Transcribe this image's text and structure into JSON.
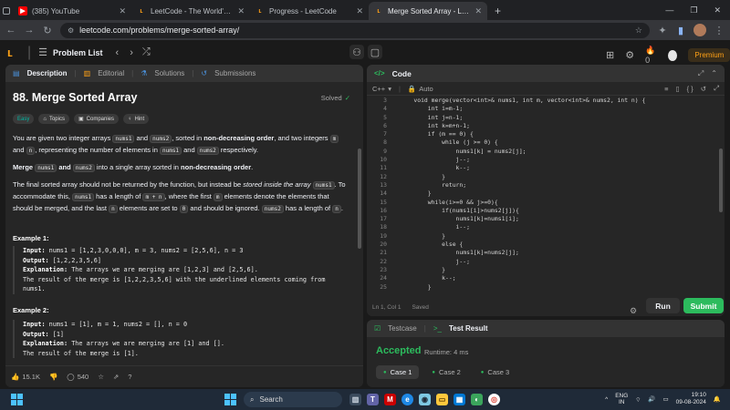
{
  "browser": {
    "tabs": [
      {
        "title": "(385) YouTube",
        "icon": "youtube-icon"
      },
      {
        "title": "LeetCode - The World's Leading",
        "icon": "leetcode-icon"
      },
      {
        "title": "Progress - LeetCode",
        "icon": "leetcode-icon"
      },
      {
        "title": "Merge Sorted Array - LeetCode",
        "icon": "leetcode-icon"
      }
    ],
    "url": "leetcode.com/problems/merge-sorted-array/"
  },
  "lcnav": {
    "problem_list": "Problem List",
    "streak": "0",
    "premium": "Premium"
  },
  "left": {
    "tabs": [
      "Description",
      "Editorial",
      "Solutions",
      "Submissions"
    ],
    "title": "88. Merge Sorted Array",
    "status": "Solved",
    "chips": [
      "Easy",
      "Topics",
      "Companies",
      "Hint"
    ],
    "p1": {
      "a": "You are given two integer arrays ",
      "c1": "nums1",
      "b": " and ",
      "c2": "nums2",
      "c": ", sorted in ",
      "bold": "non-decreasing order",
      "d": ", and two integers ",
      "c3": "m",
      "e": " and ",
      "c4": "n",
      "f": ", representing the number of elements in ",
      "c5": "nums1",
      "g": " and ",
      "c6": "nums2",
      "h": " respectively."
    },
    "p2": {
      "a": "Merge ",
      "c1": "nums1",
      "b": " and ",
      "c2": "nums2",
      "c": " into a single array sorted in ",
      "bold": "non-decreasing order",
      "d": "."
    },
    "p3": {
      "a": "The final sorted array should not be returned by the function, but instead be ",
      "ital": "stored inside the array",
      "b": " ",
      "c1": "nums1",
      "c": ". To accommodate this, ",
      "c2": "nums1",
      "d": " has a length of ",
      "c3": "m + n",
      "e": ", where the first ",
      "c4": "m",
      "f": " elements denote the elements that should be merged, and the last ",
      "c5": "n",
      "g": " elements are set to ",
      "c6": "0",
      "h": " and should be ignored. ",
      "c7": "nums2",
      "i": " has a length of ",
      "c8": "n",
      "j": "."
    },
    "example1": {
      "heading": "Example 1:",
      "input_label": "Input:",
      "input": " nums1 = [1,2,3,0,0,0], m = 3, nums2 = [2,5,6], n = 3",
      "output_label": "Output:",
      "output": " [1,2,2,3,5,6]",
      "expl_label": "Explanation:",
      "expl1": " The arrays we are merging are [1,2,3] and [2,5,6].",
      "expl2": "The result of the merge is [1,2,2,3,5,6] with the underlined elements coming from",
      "expl3": "nums1."
    },
    "example2": {
      "heading": "Example 2:",
      "input_label": "Input:",
      "input": " nums1 = [1], m = 1, nums2 = [], n = 0",
      "output_label": "Output:",
      "output": " [1]",
      "expl_label": "Explanation:",
      "expl1": " The arrays we are merging are [1] and [].",
      "expl2": "The result of the merge is [1]."
    },
    "footer": {
      "likes": "15.1K",
      "comments": "540"
    }
  },
  "code": {
    "header": "Code",
    "language": "C++",
    "mode": "Auto",
    "lines": [
      {
        "n": "3",
        "t": "    void merge(vector<int>& nums1, int m, vector<int>& nums2, int n) {"
      },
      {
        "n": "4",
        "t": "        int i=m-1;"
      },
      {
        "n": "5",
        "t": "        int j=n-1;"
      },
      {
        "n": "6",
        "t": "        int k=m+n-1;"
      },
      {
        "n": "7",
        "t": "        if (m == 0) {"
      },
      {
        "n": "8",
        "t": "            while (j >= 0) {"
      },
      {
        "n": "9",
        "t": "                nums1[k] = nums2[j];"
      },
      {
        "n": "10",
        "t": "                j--;"
      },
      {
        "n": "11",
        "t": "                k--;"
      },
      {
        "n": "12",
        "t": "            }"
      },
      {
        "n": "13",
        "t": "            return;"
      },
      {
        "n": "14",
        "t": "        }"
      },
      {
        "n": "15",
        "t": "        while(i>=0 && j>=0){"
      },
      {
        "n": "16",
        "t": "            if(nums1[i]>nums2[j]){"
      },
      {
        "n": "17",
        "t": "                nums1[k]=nums1[i];"
      },
      {
        "n": "18",
        "t": "                i--;"
      },
      {
        "n": "19",
        "t": "            }"
      },
      {
        "n": "20",
        "t": "            else {"
      },
      {
        "n": "21",
        "t": "                nums1[k]=nums2[j];"
      },
      {
        "n": "22",
        "t": "                j--;"
      },
      {
        "n": "23",
        "t": "            }"
      },
      {
        "n": "24",
        "t": "            k--;"
      },
      {
        "n": "25",
        "t": "        }"
      }
    ],
    "status": "Ln 1, Col 1",
    "saved": "Saved",
    "run": "Run",
    "submit": "Submit"
  },
  "result": {
    "tabs": [
      "Testcase",
      "Test Result"
    ],
    "verdict": "Accepted",
    "runtime": "Runtime: 4 ms",
    "cases": [
      "Case 1",
      "Case 2",
      "Case 3"
    ]
  },
  "taskbar": {
    "search": "Search",
    "lang1": "ENG",
    "lang2": "IN",
    "time": "19:10",
    "date": "09-08-2024"
  },
  "colors": {
    "accent": "#ffa116",
    "green": "#2cbb5d",
    "easy": "#00b8a3"
  }
}
